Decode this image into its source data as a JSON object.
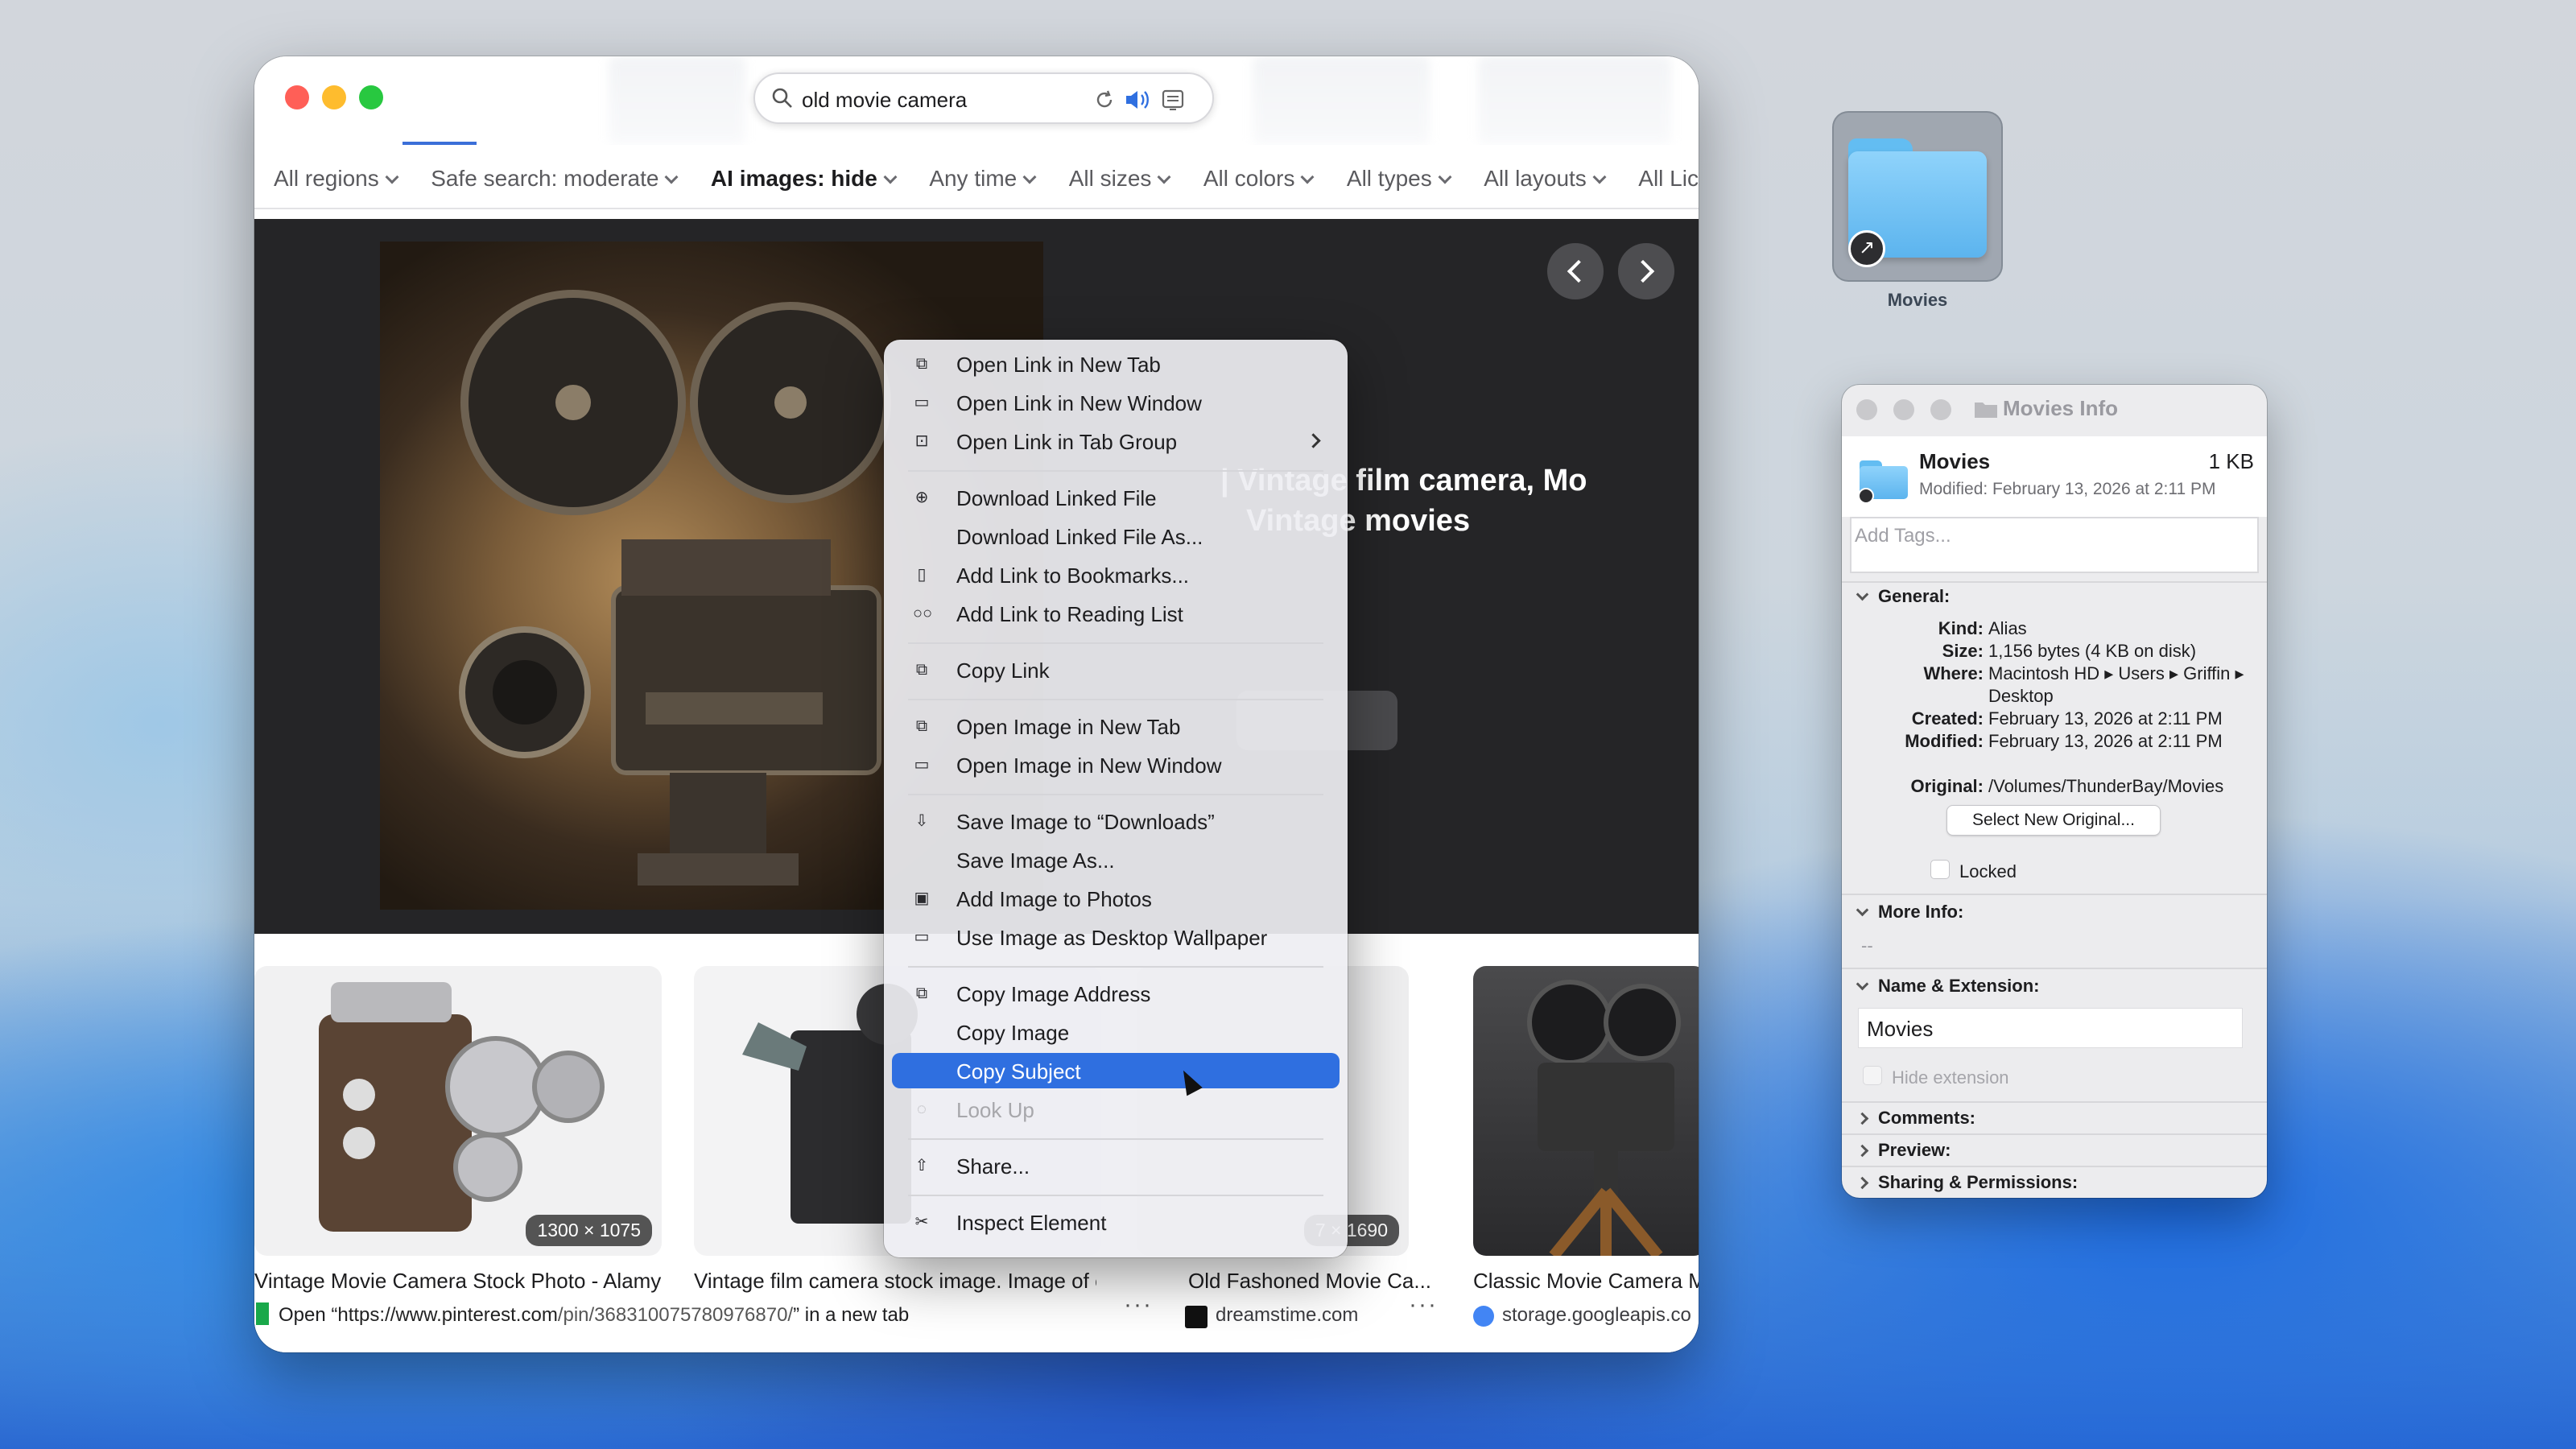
{
  "browser": {
    "search_query": "old movie camera",
    "filters": [
      {
        "label": "All regions",
        "bold": false
      },
      {
        "label": "Safe search: moderate",
        "bold": false
      },
      {
        "label": "AI images: hide",
        "bold": true
      },
      {
        "label": "Any time",
        "bold": false
      },
      {
        "label": "All sizes",
        "bold": false
      },
      {
        "label": "All colors",
        "bold": false
      },
      {
        "label": "All types",
        "bold": false
      },
      {
        "label": "All layouts",
        "bold": false
      },
      {
        "label": "All Lic",
        "bold": false
      }
    ],
    "preview_title_line1": "| Vintage film camera, Mo",
    "preview_title_line2": "Vintage movies",
    "thumbnails": [
      {
        "title": "Vintage Movie Camera Stock Photo - Alamy",
        "badge": "1300 × 1075",
        "source": ""
      },
      {
        "title": "Vintage film camera stock image. Image of colle...",
        "badge": "",
        "source": ""
      },
      {
        "title": "Old Fashoned Movie Ca...",
        "badge": "7 × 1690",
        "source": "dreamstime.com"
      },
      {
        "title": "Classic Movie Camera M",
        "badge": "",
        "source": "storage.googleapis.co"
      }
    ],
    "status_prefix": "Open “",
    "status_url_main": "https://www.pinterest.com",
    "status_url_rest": "/pin/368310075780976870/",
    "status_suffix": "” in a new tab",
    "more_dots": "···"
  },
  "context_menu": {
    "items": [
      {
        "label": "Open Link in New Tab",
        "icon": "new-tab-icon",
        "glyph": "⧉"
      },
      {
        "label": "Open Link in New Window",
        "icon": "new-window-icon",
        "glyph": "▭"
      },
      {
        "label": "Open Link in Tab Group",
        "icon": "tab-group-icon",
        "glyph": "⊡",
        "submenu": true
      },
      {
        "sep": true
      },
      {
        "label": "Download Linked File",
        "icon": "download-icon",
        "glyph": "⊕"
      },
      {
        "label": "Download Linked File As...",
        "icon": "",
        "glyph": ""
      },
      {
        "label": "Add Link to Bookmarks...",
        "icon": "bookmarks-icon",
        "glyph": "▯"
      },
      {
        "label": "Add Link to Reading List",
        "icon": "reading-list-icon",
        "glyph": "○○"
      },
      {
        "sep": true
      },
      {
        "label": "Copy Link",
        "icon": "copy-icon",
        "glyph": "⧉"
      },
      {
        "sep": true
      },
      {
        "label": "Open Image in New Tab",
        "icon": "new-tab-icon",
        "glyph": "⧉"
      },
      {
        "label": "Open Image in New Window",
        "icon": "new-window-icon",
        "glyph": "▭"
      },
      {
        "sep": true
      },
      {
        "label": "Save Image to “Downloads”",
        "icon": "save-icon",
        "glyph": "⇩"
      },
      {
        "label": "Save Image As...",
        "icon": "",
        "glyph": ""
      },
      {
        "label": "Add Image to Photos",
        "icon": "photos-icon",
        "glyph": "▣"
      },
      {
        "label": "Use Image as Desktop Wallpaper",
        "icon": "wallpaper-icon",
        "glyph": "▭"
      },
      {
        "sep": true
      },
      {
        "label": "Copy Image Address",
        "icon": "copy-icon",
        "glyph": "⧉"
      },
      {
        "label": "Copy Image",
        "icon": "",
        "glyph": ""
      },
      {
        "label": "Copy Subject",
        "icon": "",
        "glyph": "",
        "highlighted": true
      },
      {
        "label": "Look Up",
        "icon": "look-up-icon",
        "glyph": "◌",
        "disabled": true
      },
      {
        "sep": true
      },
      {
        "label": "Share...",
        "icon": "share-icon",
        "glyph": "⇧"
      },
      {
        "sep": true
      },
      {
        "label": "Inspect Element",
        "icon": "inspect-icon",
        "glyph": "✂"
      }
    ]
  },
  "desktop_icon": {
    "label": "Movies"
  },
  "info_window": {
    "title": "Movies Info",
    "name": "Movies",
    "size_short": "1 KB",
    "modified_line": "Modified: February 13, 2026 at 2:11 PM",
    "tags_placeholder": "Add Tags...",
    "general_label": "General:",
    "kind_k": "Kind:",
    "kind_v": "Alias",
    "size_k": "Size:",
    "size_v": "1,156 bytes (4 KB on disk)",
    "where_k": "Where:",
    "where_v1": "Macintosh HD ▸ Users ▸ Griffin ▸",
    "where_v2": "Desktop",
    "created_k": "Created:",
    "created_v": "February 13, 2026 at 2:11 PM",
    "modified_k": "Modified:",
    "modified_v": "February 13, 2026 at 2:11 PM",
    "original_k": "Original:",
    "original_v": "/Volumes/ThunderBay/Movies",
    "select_button": "Select New Original...",
    "locked_label": "Locked",
    "more_info_label": "More Info:",
    "more_info_value": "--",
    "name_ext_label": "Name & Extension:",
    "name_field": "Movies",
    "hide_ext_label": "Hide extension",
    "comments_label": "Comments:",
    "preview_label": "Preview:",
    "sharing_label": "Sharing & Permissions:"
  },
  "colors": {
    "accent": "#2f6fe0",
    "close": "#ff5f57",
    "minimize": "#febc2e",
    "zoom": "#28c840"
  }
}
